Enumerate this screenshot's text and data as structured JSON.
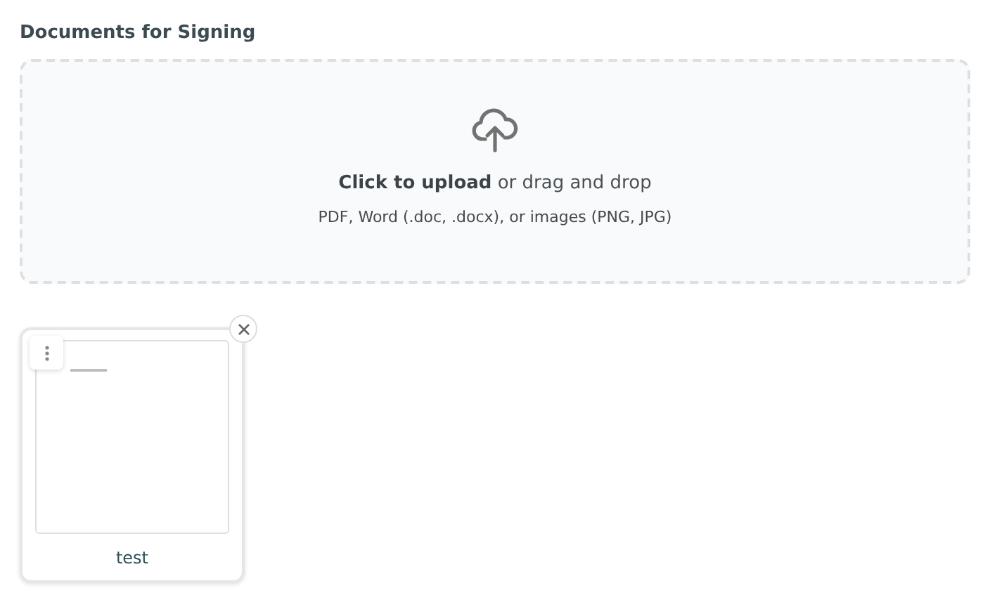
{
  "section_title": "Documents for Signing",
  "upload": {
    "prompt": "**Click to upload** or drag and drop",
    "hint": "PDF, Word (.doc, .docx), or images (PNG, JPG)"
  },
  "documents": [
    {
      "name": "test"
    }
  ]
}
